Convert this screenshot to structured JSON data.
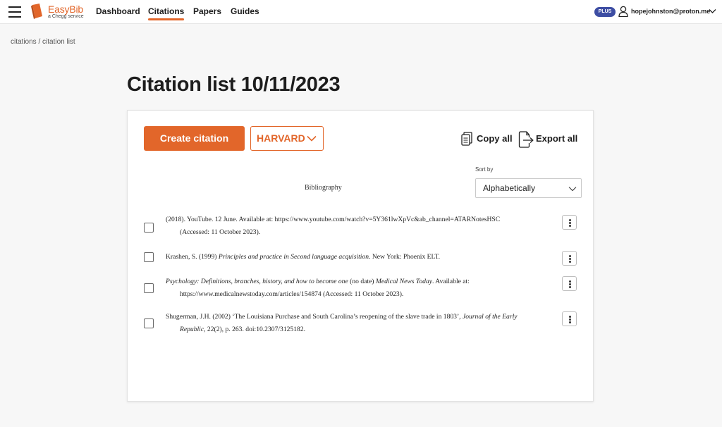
{
  "brand": {
    "name": "EasyBib",
    "tagline": "a Chegg service",
    "accent": "#e2662a"
  },
  "nav": {
    "items": [
      {
        "label": "Dashboard"
      },
      {
        "label": "Citations",
        "active": true
      },
      {
        "label": "Papers"
      },
      {
        "label": "Guides"
      }
    ]
  },
  "user": {
    "plan_badge": "PLUS",
    "email": "hopejohnston@proton.me"
  },
  "breadcrumb": "citations / citation list",
  "page_title": "Citation list 10/11/2023",
  "toolbar": {
    "create_label": "Create citation",
    "style_label": "HARVARD",
    "copy_all_label": "Copy all",
    "export_all_label": "Export all"
  },
  "sort": {
    "label": "Sort by",
    "selected": "Alphabetically"
  },
  "bibliography_label": "Bibliography",
  "citations": [
    {
      "line1": "(2018). YouTube. 12 June. Available at: https://www.youtube.com/watch?v=5Y361lwXpVc&ab_channel=ATARNotesHSC",
      "line2": "(Accessed: 11 October 2023)."
    },
    {
      "author": "Krashen, S. (1999) ",
      "title": "Principles and practice in Second language acquisition",
      "rest": ". New York: Phoenix ELT."
    },
    {
      "title": "Psychology: Definitions, branches, history, and how to become one",
      "mid": " (no date) ",
      "source": "Medical News Today",
      "rest": ". Available at:",
      "line2": "https://www.medicalnewstoday.com/articles/154874 (Accessed: 11 October 2023)."
    },
    {
      "author": "Shugerman, J.H. (2002) ‘The Louisiana Purchase and South Carolina’s reopening of the slave trade in 1803’, ",
      "journal": "Journal of the Early",
      "journal2": "Republic",
      "rest": ", 22(2), p. 263. doi:10.2307/3125182."
    }
  ]
}
